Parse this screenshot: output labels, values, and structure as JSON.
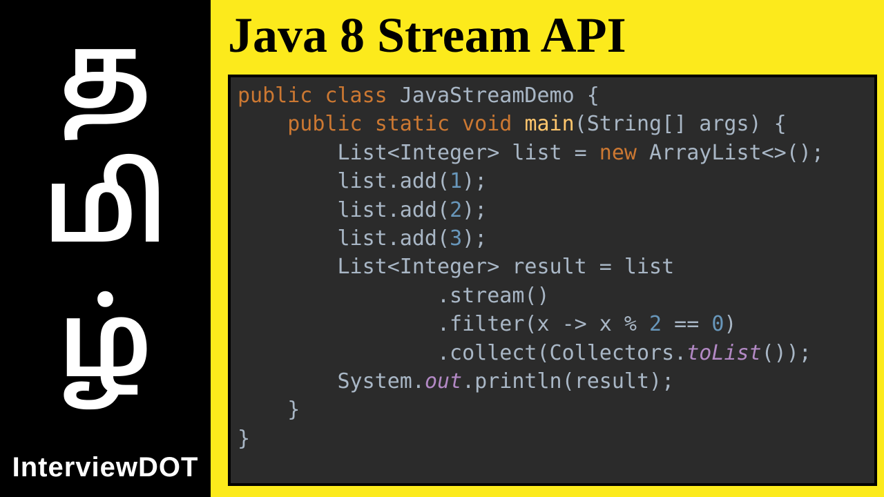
{
  "sidebar": {
    "tamil_chars": [
      "த",
      "மி",
      "ழ்"
    ],
    "brand": "InterviewDOT"
  },
  "title": "Java 8 Stream API",
  "code": {
    "line1_kw1": "public",
    "line1_kw2": "class",
    "line1_class": "JavaStreamDemo {",
    "line2_kw1": "public",
    "line2_kw2": "static",
    "line2_kw3": "void",
    "line2_method": "main",
    "line2_rest": "(String[] args) {",
    "line3_a": "List<Integer> list = ",
    "line3_kw": "new",
    "line3_b": " ArrayList<>();",
    "line4_a": "list.add(",
    "line4_num": "1",
    "line4_b": ");",
    "line5_a": "list.add(",
    "line5_num": "2",
    "line5_b": ");",
    "line6_a": "list.add(",
    "line6_num": "3",
    "line6_b": ");",
    "line7": "List<Integer> result = list",
    "line8": ".stream()",
    "line9_a": ".filter(x -> x % ",
    "line9_num1": "2",
    "line9_b": " == ",
    "line9_num2": "0",
    "line9_c": ")",
    "line10_a": ".collect(Collectors.",
    "line10_italic": "toList",
    "line10_b": "());",
    "line11_a": "System.",
    "line11_italic": "out",
    "line11_b": ".println(result);",
    "line12": "}",
    "line13": "}"
  }
}
